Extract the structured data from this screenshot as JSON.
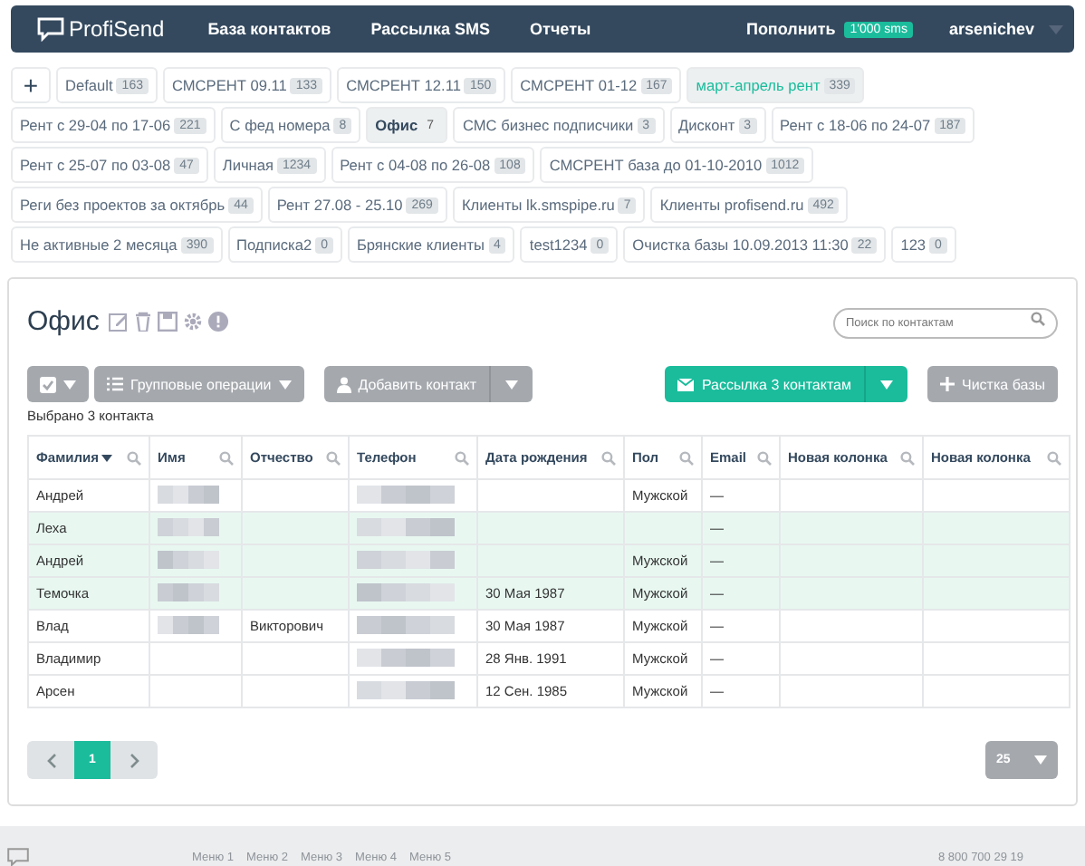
{
  "nav": {
    "logo": "ProfiSend",
    "items": [
      "База контактов",
      "Рассылка SMS",
      "Отчеты"
    ],
    "topup": "Пополнить",
    "balance": "1'000 sms",
    "user": "arsenichev"
  },
  "add_group": "+",
  "group_rows": [
    [
      {
        "label": "Default",
        "count": "163",
        "selected": false,
        "highlighted": false
      },
      {
        "label": "СМСРЕНТ 09.11",
        "count": "133",
        "selected": false,
        "highlighted": false
      },
      {
        "label": "СМСРЕНТ 12.11",
        "count": "150",
        "selected": false,
        "highlighted": false
      },
      {
        "label": "СМСРЕНТ 01-12",
        "count": "167",
        "selected": false,
        "highlighted": false
      },
      {
        "label": "март-апрель рент",
        "count": "339",
        "selected": false,
        "highlighted": true
      }
    ],
    [
      {
        "label": "Рент с 29-04 по 17-06",
        "count": "221",
        "selected": false,
        "highlighted": false
      },
      {
        "label": "С фед номера",
        "count": "8",
        "selected": false,
        "highlighted": false
      },
      {
        "label": "Офис",
        "count": "7",
        "selected": true,
        "highlighted": false
      },
      {
        "label": "СМС бизнес подписчики",
        "count": "3",
        "selected": false,
        "highlighted": false
      },
      {
        "label": "Дисконт",
        "count": "3",
        "selected": false,
        "highlighted": false
      },
      {
        "label": "Рент с 18-06 по 24-07",
        "count": "187",
        "selected": false,
        "highlighted": false
      }
    ],
    [
      {
        "label": "Рент с 25-07 по 03-08",
        "count": "47",
        "selected": false,
        "highlighted": false
      },
      {
        "label": "Личная",
        "count": "1234",
        "selected": false,
        "highlighted": false
      },
      {
        "label": "Рент с 04-08 по 26-08",
        "count": "108",
        "selected": false,
        "highlighted": false
      },
      {
        "label": "СМСРЕНТ база до 01-10-2010",
        "count": "1012",
        "selected": false,
        "highlighted": false
      }
    ],
    [
      {
        "label": "Реги без проектов за октябрь",
        "count": "44",
        "selected": false,
        "highlighted": false
      },
      {
        "label": "Рент 27.08 - 25.10",
        "count": "269",
        "selected": false,
        "highlighted": false
      },
      {
        "label": "Клиенты lk.smspipe.ru",
        "count": "7",
        "selected": false,
        "highlighted": false
      },
      {
        "label": "Клиенты profisend.ru",
        "count": "492",
        "selected": false,
        "highlighted": false
      }
    ],
    [
      {
        "label": "Не активные 2 месяца",
        "count": "390",
        "selected": false,
        "highlighted": false
      },
      {
        "label": "Подписка2",
        "count": "0",
        "selected": false,
        "highlighted": false
      },
      {
        "label": "Брянские клиенты",
        "count": "4",
        "selected": false,
        "highlighted": false
      },
      {
        "label": "test1234",
        "count": "0",
        "selected": false,
        "highlighted": false
      },
      {
        "label": "Очистка базы 10.09.2013 11:30",
        "count": "22",
        "selected": false,
        "highlighted": false
      },
      {
        "label": "123",
        "count": "0",
        "selected": false,
        "highlighted": false
      }
    ]
  ],
  "panel": {
    "title": "Офис",
    "search": {
      "placeholder": "Поиск по контактам"
    },
    "toolbar": {
      "group_ops": "Групповые операции",
      "add_contact": "Добавить контакт",
      "send": "Рассылка 3 контактам",
      "clean": "Чистка базы"
    },
    "selected_info": "Выбрано 3 контакта",
    "table": {
      "columns": [
        {
          "label": "Фамилия",
          "sorted": true
        },
        {
          "label": "Имя",
          "sorted": false
        },
        {
          "label": "Отчество",
          "sorted": false
        },
        {
          "label": "Телефон",
          "sorted": false
        },
        {
          "label": "Дата рождения",
          "sorted": false
        },
        {
          "label": "Пол",
          "sorted": false
        },
        {
          "label": "Email",
          "sorted": false
        },
        {
          "label": "Новая колонка",
          "sorted": false
        },
        {
          "label": "Новая колонка",
          "sorted": false
        }
      ],
      "rows": [
        {
          "selected": false,
          "cells": [
            {
              "kind": "text",
              "text": "Андрей"
            },
            {
              "kind": "blurred"
            },
            {
              "kind": "empty"
            },
            {
              "kind": "blurred"
            },
            {
              "kind": "empty"
            },
            {
              "kind": "text",
              "text": "Мужской"
            },
            {
              "kind": "text",
              "text": "—"
            },
            {
              "kind": "empty"
            },
            {
              "kind": "empty"
            }
          ]
        },
        {
          "selected": true,
          "cells": [
            {
              "kind": "text",
              "text": "Леха"
            },
            {
              "kind": "blurred"
            },
            {
              "kind": "empty"
            },
            {
              "kind": "blurred"
            },
            {
              "kind": "empty"
            },
            {
              "kind": "empty"
            },
            {
              "kind": "text",
              "text": "—"
            },
            {
              "kind": "empty"
            },
            {
              "kind": "empty"
            }
          ]
        },
        {
          "selected": true,
          "cells": [
            {
              "kind": "text",
              "text": "Андрей"
            },
            {
              "kind": "blurred"
            },
            {
              "kind": "empty"
            },
            {
              "kind": "blurred"
            },
            {
              "kind": "empty"
            },
            {
              "kind": "text",
              "text": "Мужской"
            },
            {
              "kind": "text",
              "text": "—"
            },
            {
              "kind": "empty"
            },
            {
              "kind": "empty"
            }
          ]
        },
        {
          "selected": true,
          "cells": [
            {
              "kind": "text",
              "text": "Темочка"
            },
            {
              "kind": "blurred"
            },
            {
              "kind": "empty"
            },
            {
              "kind": "blurred"
            },
            {
              "kind": "text",
              "text": "30 Мая 1987"
            },
            {
              "kind": "text",
              "text": "Мужской"
            },
            {
              "kind": "text",
              "text": "—"
            },
            {
              "kind": "empty"
            },
            {
              "kind": "empty"
            }
          ]
        },
        {
          "selected": false,
          "cells": [
            {
              "kind": "text",
              "text": "Влад"
            },
            {
              "kind": "blurred"
            },
            {
              "kind": "text",
              "text": "Викторович"
            },
            {
              "kind": "blurred"
            },
            {
              "kind": "text",
              "text": "30 Мая 1987"
            },
            {
              "kind": "text",
              "text": "Мужской"
            },
            {
              "kind": "text",
              "text": "—"
            },
            {
              "kind": "empty"
            },
            {
              "kind": "empty"
            }
          ]
        },
        {
          "selected": false,
          "cells": [
            {
              "kind": "text",
              "text": "Владимир"
            },
            {
              "kind": "empty"
            },
            {
              "kind": "empty"
            },
            {
              "kind": "blurred"
            },
            {
              "kind": "text",
              "text": "28 Янв. 1991"
            },
            {
              "kind": "text",
              "text": "Мужской"
            },
            {
              "kind": "text",
              "text": "—"
            },
            {
              "kind": "empty"
            },
            {
              "kind": "empty"
            }
          ]
        },
        {
          "selected": false,
          "cells": [
            {
              "kind": "text",
              "text": "Арсен"
            },
            {
              "kind": "empty"
            },
            {
              "kind": "empty"
            },
            {
              "kind": "blurred"
            },
            {
              "kind": "text",
              "text": "12 Сен. 1985"
            },
            {
              "kind": "text",
              "text": "Мужской"
            },
            {
              "kind": "text",
              "text": "—"
            },
            {
              "kind": "empty"
            },
            {
              "kind": "empty"
            }
          ]
        }
      ]
    },
    "pages": [
      {
        "label": "1",
        "selected": true
      }
    ],
    "per_page": "25"
  },
  "footer": {
    "menu": [
      "Меню 1",
      "Меню 2",
      "Меню 3",
      "Меню 4",
      "Меню 5"
    ],
    "phone": "8 800 700 29 19"
  }
}
